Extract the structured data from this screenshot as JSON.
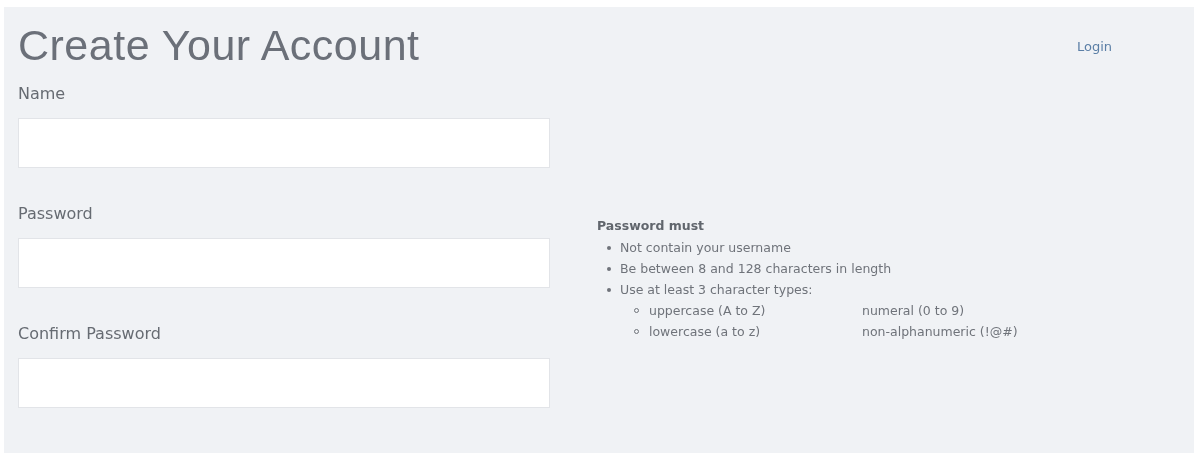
{
  "title": "Create Your Account",
  "login_link": "Login",
  "fields": [
    {
      "label": "Name"
    },
    {
      "label": "Password"
    },
    {
      "label": "Confirm Password"
    }
  ],
  "password_rules": {
    "heading": "Password must",
    "items": [
      {
        "text": "Not contain your username"
      },
      {
        "text": "Be between 8 and 128 characters in length"
      },
      {
        "text": "Use at least 3 character types:",
        "children": [
          {
            "text": "uppercase (A to Z)"
          },
          {
            "text": "numeral (0 to 9)"
          },
          {
            "text": "lowercase (a to z)"
          },
          {
            "text": "non-alphanumeric (!@#)"
          }
        ]
      }
    ]
  }
}
